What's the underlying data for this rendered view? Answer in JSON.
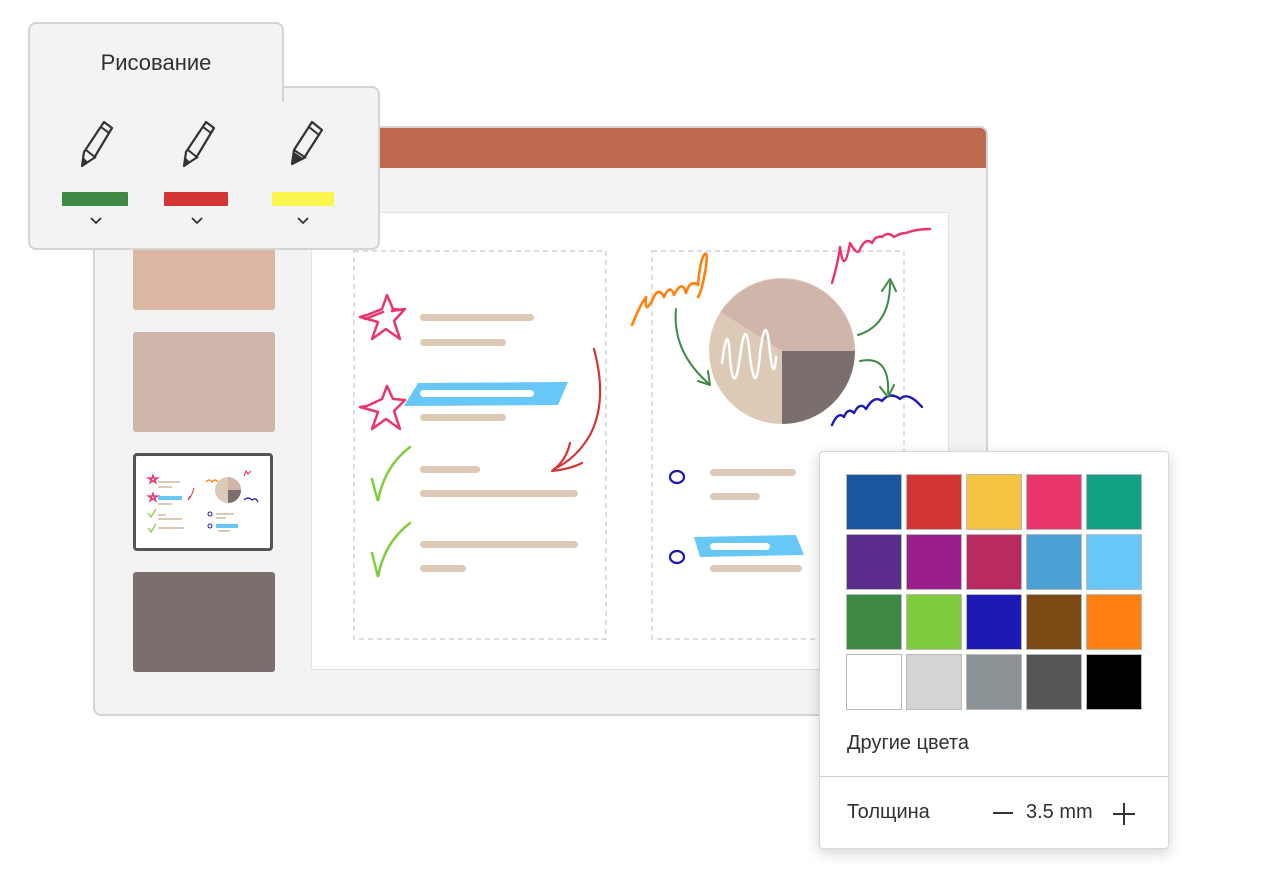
{
  "ribbon": {
    "tab_label": "Рисование",
    "pens": [
      {
        "icon": "pen-icon",
        "color": "#3e8a44"
      },
      {
        "icon": "pen-icon",
        "color": "#d33535"
      },
      {
        "icon": "highlighter-icon",
        "color": "#f9f74e"
      }
    ]
  },
  "color_picker": {
    "swatches": [
      "#1a55a0",
      "#d33535",
      "#f5c342",
      "#e8366b",
      "#13a185",
      "#5a2d8c",
      "#9a1e8c",
      "#b82a60",
      "#4a9fd5",
      "#67c8f8",
      "#3e8a44",
      "#80cc3c",
      "#1d19b5",
      "#7c4a13",
      "#ff8010",
      "#ffffff",
      "#d4d4d4",
      "#8b9396",
      "#565656",
      "#000000"
    ],
    "more_colors_label": "Другие цвета",
    "thickness_label": "Толщина",
    "thickness_value": "3.5 mm"
  },
  "colors": {
    "titlebar": "#bd6a50",
    "text_placeholder": "#dccab7",
    "highlight": "#67c8f8"
  }
}
